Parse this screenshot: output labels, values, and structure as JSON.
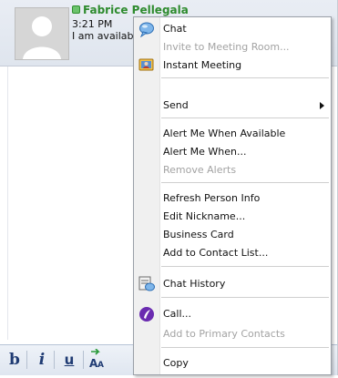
{
  "contact": {
    "name": "Fabrice Pellegala",
    "time": "3:21 PM",
    "status": "I am availab"
  },
  "toolbar": {
    "bold": "b",
    "italic": "i",
    "underline": "u",
    "font": "A"
  },
  "menu": {
    "chat": "Chat",
    "invite": "Invite to Meeting Room...",
    "instant_meeting": "Instant Meeting",
    "send": "Send",
    "alert_available": "Alert Me When Available",
    "alert_when": "Alert Me When...",
    "remove_alerts": "Remove Alerts",
    "refresh": "Refresh Person Info",
    "edit_nickname": "Edit Nickname...",
    "business_card": "Business Card",
    "add_contact": "Add to Contact List...",
    "chat_history": "Chat History",
    "call": "Call...",
    "add_primary": "Add to Primary Contacts",
    "copy": "Copy"
  },
  "icons": {
    "chat": "chat-bubble-icon",
    "instant_meeting": "meeting-icon",
    "chat_history": "chat-history-icon",
    "call": "call-icon",
    "presence": "presence-available-icon"
  },
  "colors": {
    "presence_green": "#2e8b2e",
    "toolbar_text": "#1f3b73",
    "disabled_text": "#a3a3a3"
  }
}
